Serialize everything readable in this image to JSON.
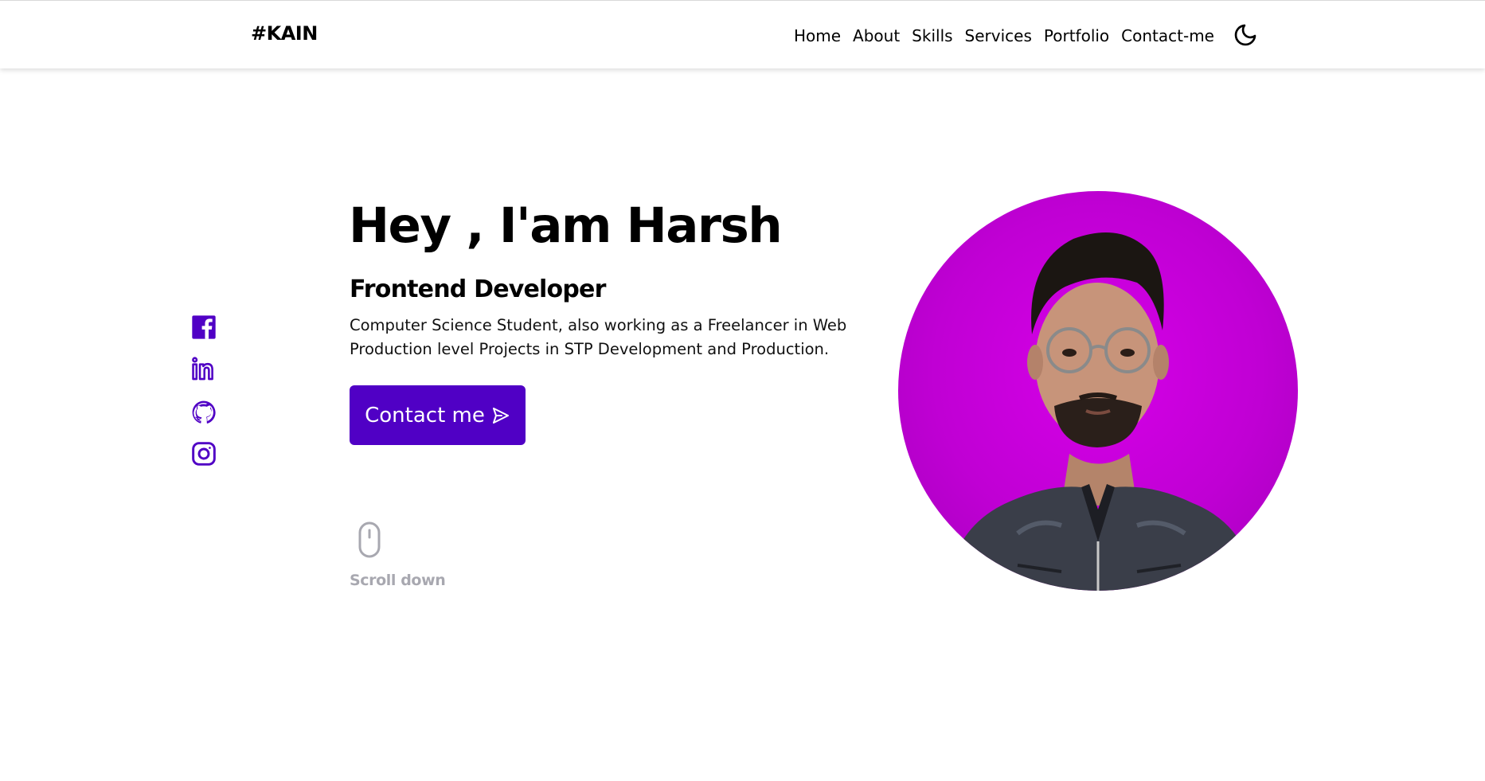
{
  "header": {
    "logo": "#KAIN",
    "nav": [
      "Home",
      "About",
      "Skills",
      "Services",
      "Portfolio",
      "Contact-me"
    ],
    "theme_icon": "moon-icon"
  },
  "social": {
    "icons": [
      "facebook-icon",
      "linkedin-icon",
      "github-icon",
      "instagram-icon"
    ],
    "color": "#5000c5"
  },
  "hero": {
    "title": "Hey , I'am Harsh",
    "subtitle": "Frontend Developer",
    "description": "Computer Science Student, also working as a Freelancer in Web Production level Projects in STP Development and Production.",
    "cta_label": "Contact me",
    "cta_icon": "send-icon",
    "scroll_label": "Scroll down",
    "scroll_icon": "mouse-icon"
  },
  "colors": {
    "accent": "#5000c5",
    "avatar_bg": "#c000d4",
    "muted": "#a8a8b0"
  }
}
